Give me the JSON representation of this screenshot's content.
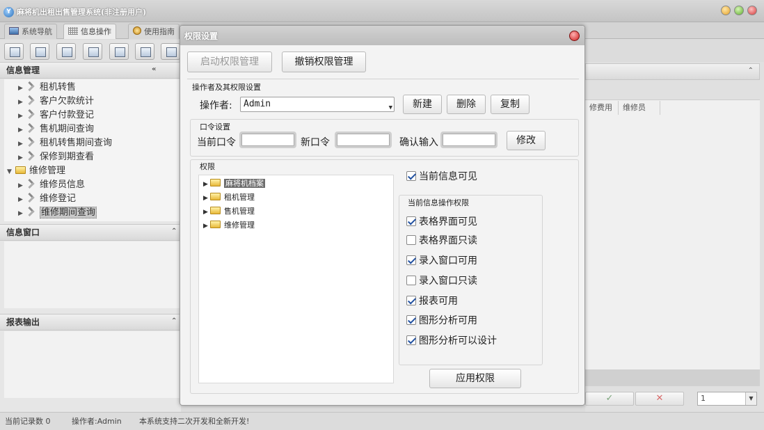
{
  "app": {
    "title": "麻将机出租出售管理系统(非注册用户)",
    "icon": "app-logo-icon"
  },
  "tabs": [
    {
      "label": "系统导航",
      "icon": "monitor-icon"
    },
    {
      "label": "信息操作",
      "icon": "grid-icon"
    },
    {
      "label": "使用指南",
      "icon": "guide-icon"
    }
  ],
  "left_panel": {
    "header": "信息管理",
    "tree": [
      {
        "label": "租机转售",
        "type": "leaf"
      },
      {
        "label": "客户欠款统计",
        "type": "leaf"
      },
      {
        "label": "客户付款登记",
        "type": "leaf"
      },
      {
        "label": "售机期间查询",
        "type": "leaf"
      },
      {
        "label": "租机转售期间查询",
        "type": "leaf"
      },
      {
        "label": "保修到期查看",
        "type": "leaf"
      },
      {
        "label": "维修管理",
        "type": "folder"
      },
      {
        "label": "维修员信息",
        "type": "leaf"
      },
      {
        "label": "维修登记",
        "type": "leaf"
      },
      {
        "label": "维修期间查询",
        "type": "leaf",
        "selected": true
      }
    ],
    "info_window": "信息窗口",
    "report_output": "报表输出"
  },
  "right_area": {
    "columns": [
      "修费用",
      "维修员"
    ],
    "page_value": "1"
  },
  "status": {
    "record_count": "当前记录数 0",
    "operator": "操作者:Admin",
    "notice": "本系统支持二次开发和全新开发!"
  },
  "dialog": {
    "title": "权限设置",
    "enable_button": "启动权限管理",
    "revoke_button": "撤销权限管理",
    "operator_section": "操作者及其权限设置",
    "operator_label": "操作者:",
    "operator_value": "Admin",
    "new_button": "新建",
    "delete_button": "删除",
    "copy_button": "复制",
    "password_section": "口令设置",
    "current_pwd_label": "当前口令",
    "new_pwd_label": "新口令",
    "confirm_pwd_label": "确认输入",
    "modify_button": "修改",
    "permission_section": "权限",
    "permission_tree": [
      {
        "label": "麻将机档案",
        "selected": true
      },
      {
        "label": "租机管理"
      },
      {
        "label": "售机管理"
      },
      {
        "label": "维修管理"
      }
    ],
    "current_visible": {
      "label": "当前信息可见",
      "checked": true
    },
    "op_section": "当前信息操作权限",
    "op_permissions": [
      {
        "label": "表格界面可见",
        "checked": true
      },
      {
        "label": "表格界面只读",
        "checked": false
      },
      {
        "label": "录入窗口可用",
        "checked": true
      },
      {
        "label": "录入窗口只读",
        "checked": false
      },
      {
        "label": "报表可用",
        "checked": true
      },
      {
        "label": "图形分析可用",
        "checked": true
      },
      {
        "label": "图形分析可以设计",
        "checked": true
      }
    ],
    "apply_button": "应用权限"
  }
}
